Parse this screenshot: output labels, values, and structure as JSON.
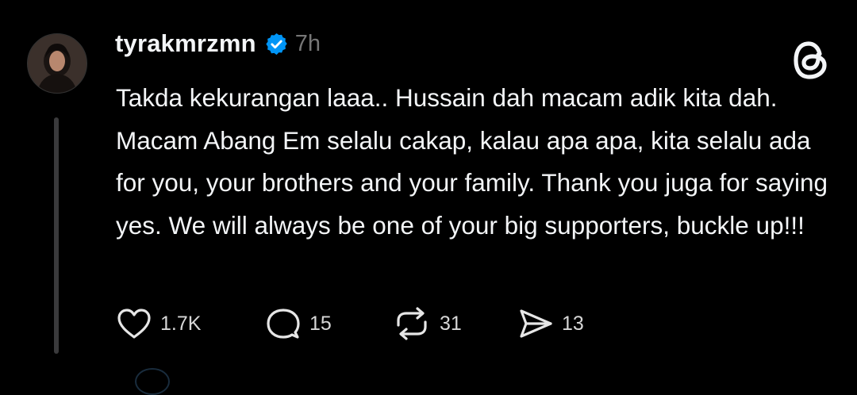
{
  "post": {
    "author": {
      "username": "tyrakmrzmn",
      "verified": true,
      "verified_badge_icon": "verified-badge-icon",
      "avatar_icon": "profile-photo"
    },
    "time_ago": "7h",
    "app_logo_icon": "threads-logo-icon",
    "text": "Takda kekurangan laaa.. Hussain dah macam adik kita dah. Macam Abang Em selalu cakap, kalau apa apa, kita selalu ada for you, your brothers and your family. Thank you juga for saying yes. We will always be one of your big supporters, buckle up!!!",
    "actions": {
      "like": {
        "icon": "heart-icon",
        "count": "1.7K"
      },
      "reply": {
        "icon": "comment-bubble-icon",
        "count": "15"
      },
      "repost": {
        "icon": "repost-icon",
        "count": "31"
      },
      "share": {
        "icon": "send-icon",
        "count": "13"
      }
    }
  },
  "colors": {
    "background": "#000000",
    "text": "#f3f5f7",
    "muted": "#777777",
    "verified_blue": "#0095f6",
    "thread_line": "#3a3a3c"
  }
}
